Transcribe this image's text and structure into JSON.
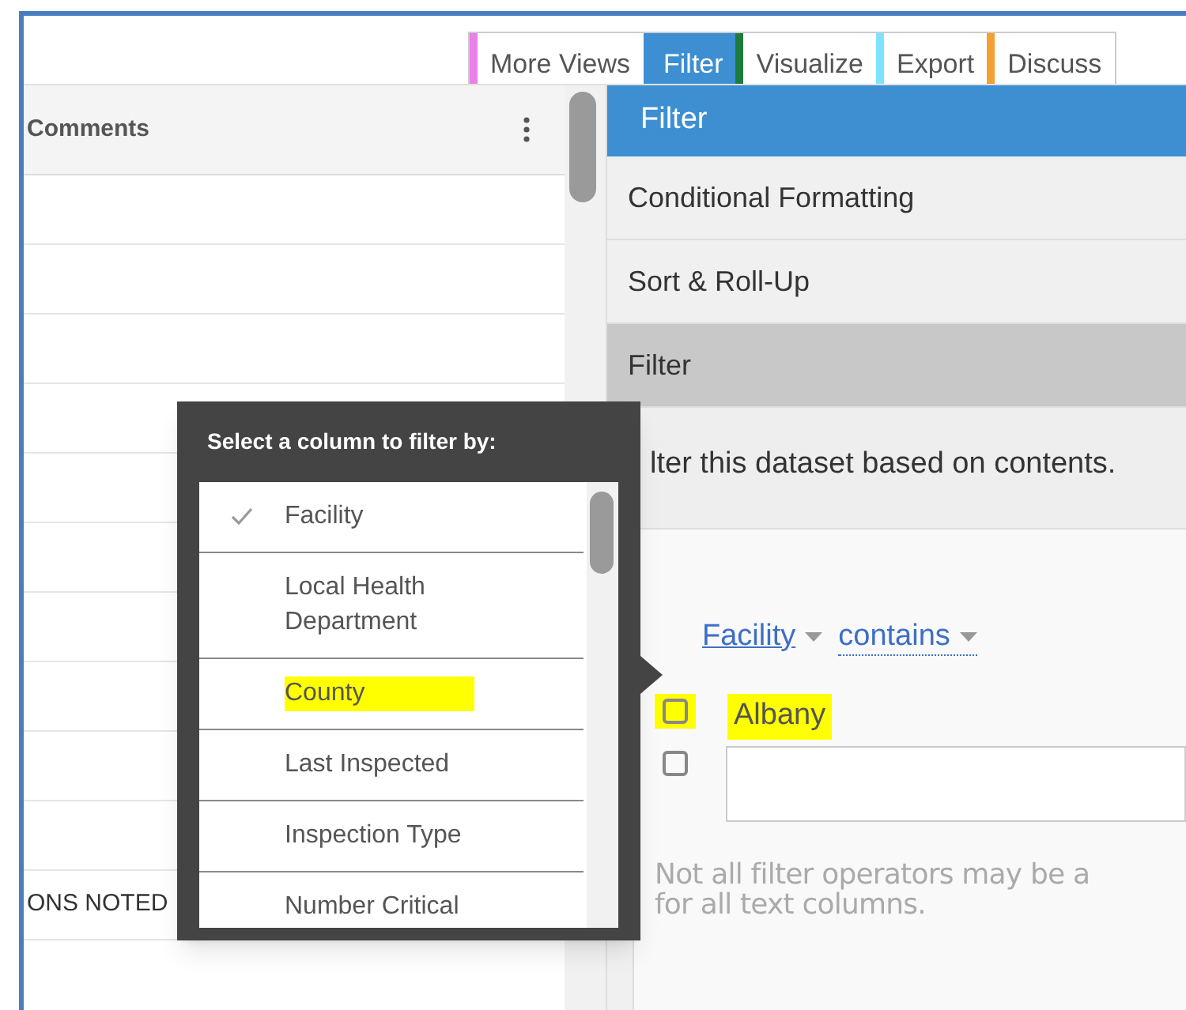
{
  "tabs": [
    {
      "label": "More Views",
      "selected": false,
      "color": "#ea80e8"
    },
    {
      "label": "Filter",
      "selected": true,
      "color": "#3d8fd1"
    },
    {
      "label": "Visualize",
      "selected": false,
      "color": "#1e7b3c"
    },
    {
      "label": "Export",
      "selected": false,
      "color": "#7fe3ff"
    },
    {
      "label": "Discuss",
      "selected": false,
      "color": "#f5a031"
    }
  ],
  "grid": {
    "column": "Comments",
    "rows": [
      {
        "comments": "ONS NOTED"
      }
    ]
  },
  "panel": {
    "title": "Filter",
    "sections": [
      {
        "label": "Conditional Formatting",
        "selected": false
      },
      {
        "label": "Sort & Roll-Up",
        "selected": false
      },
      {
        "label": "Filter",
        "selected": true
      }
    ],
    "description": "lter this dataset based on contents.",
    "condition": {
      "column": "Facility",
      "operator": "contains"
    },
    "options": [
      {
        "kind": "value",
        "label": "Albany",
        "checked": false,
        "highlighted": true
      },
      {
        "kind": "input",
        "checked": false,
        "highlighted": false
      }
    ],
    "hint": "Not all filter operators may be a\nfor all text columns."
  },
  "column_picker": {
    "title": "Select a column to filter by:",
    "items": [
      {
        "label": "Facility",
        "selected": true,
        "highlighted": false
      },
      {
        "label": "Local Health Department",
        "selected": false,
        "highlighted": false
      },
      {
        "label": "County",
        "selected": false,
        "highlighted": true
      },
      {
        "label": "Last Inspected",
        "selected": false,
        "highlighted": false
      },
      {
        "label": "Inspection Type",
        "selected": false,
        "highlighted": false
      },
      {
        "label": "Number Critical",
        "selected": false,
        "highlighted": false
      }
    ]
  }
}
